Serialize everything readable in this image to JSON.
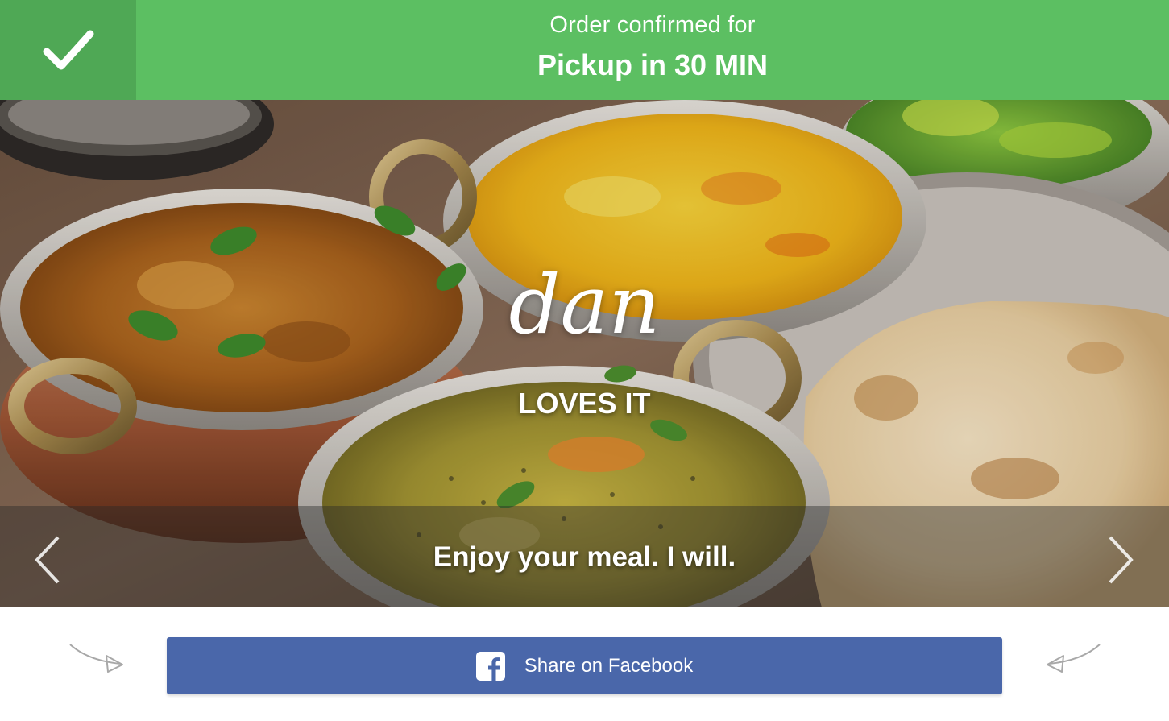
{
  "banner": {
    "line1": "Order confirmed for",
    "line2": "Pickup in 30 MIN",
    "check_icon": "checkmark-icon",
    "color": "#5cbf62",
    "check_bg_color": "#4fa855"
  },
  "hero": {
    "title": "dan",
    "subtitle": "LOVES IT",
    "caption": "Enjoy your meal. I will.",
    "prev_icon": "chevron-left-icon",
    "next_icon": "chevron-right-icon"
  },
  "share": {
    "button_label": "Share on Facebook",
    "button_icon": "facebook-icon",
    "button_color": "#4a67aa",
    "left_decor_icon": "curved-arrow-right-icon",
    "right_decor_icon": "curved-arrow-left-icon"
  }
}
